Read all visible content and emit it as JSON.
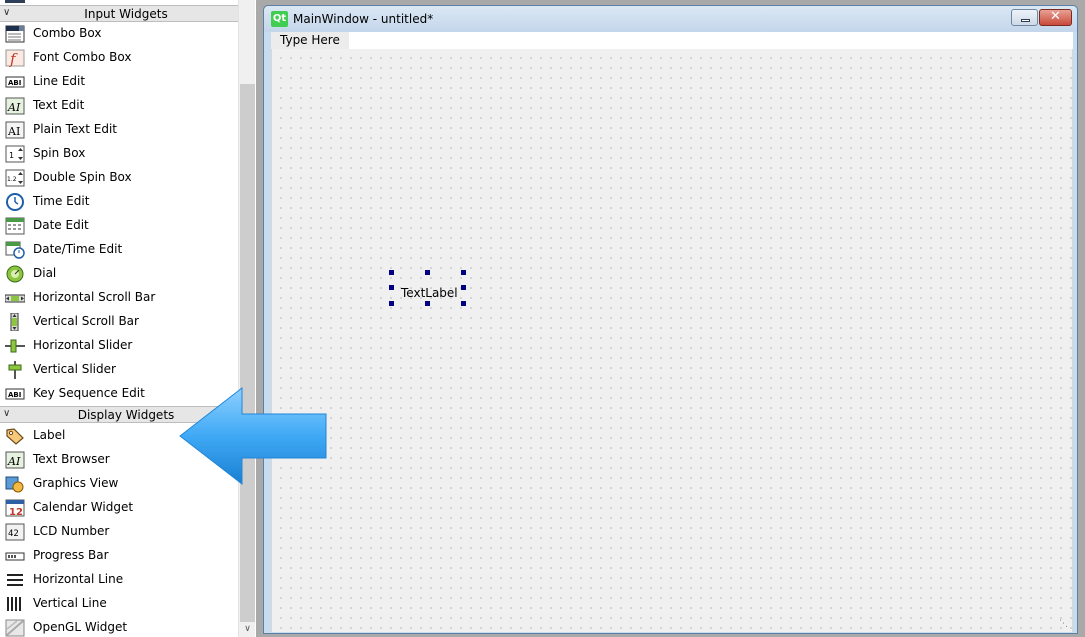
{
  "widget_box": {
    "categories": [
      {
        "title": "Input Widgets",
        "items": [
          {
            "label": "Combo Box",
            "icon": "combo-box-icon"
          },
          {
            "label": "Font Combo Box",
            "icon": "font-combo-box-icon"
          },
          {
            "label": "Line Edit",
            "icon": "line-edit-icon"
          },
          {
            "label": "Text Edit",
            "icon": "text-edit-icon"
          },
          {
            "label": "Plain Text Edit",
            "icon": "plain-text-edit-icon"
          },
          {
            "label": "Spin Box",
            "icon": "spin-box-icon"
          },
          {
            "label": "Double Spin Box",
            "icon": "double-spin-box-icon"
          },
          {
            "label": "Time Edit",
            "icon": "time-edit-icon"
          },
          {
            "label": "Date Edit",
            "icon": "date-edit-icon"
          },
          {
            "label": "Date/Time Edit",
            "icon": "date-time-edit-icon"
          },
          {
            "label": "Dial",
            "icon": "dial-icon"
          },
          {
            "label": "Horizontal Scroll Bar",
            "icon": "horizontal-scroll-bar-icon"
          },
          {
            "label": "Vertical Scroll Bar",
            "icon": "vertical-scroll-bar-icon"
          },
          {
            "label": "Horizontal Slider",
            "icon": "horizontal-slider-icon"
          },
          {
            "label": "Vertical Slider",
            "icon": "vertical-slider-icon"
          },
          {
            "label": "Key Sequence Edit",
            "icon": "key-sequence-edit-icon"
          }
        ]
      },
      {
        "title": "Display Widgets",
        "items": [
          {
            "label": "Label",
            "icon": "label-tag-icon"
          },
          {
            "label": "Text Browser",
            "icon": "text-browser-icon"
          },
          {
            "label": "Graphics View",
            "icon": "graphics-view-icon"
          },
          {
            "label": "Calendar Widget",
            "icon": "calendar-widget-icon"
          },
          {
            "label": "LCD Number",
            "icon": "lcd-number-icon"
          },
          {
            "label": "Progress Bar",
            "icon": "progress-bar-icon"
          },
          {
            "label": "Horizontal Line",
            "icon": "horizontal-line-icon"
          },
          {
            "label": "Vertical Line",
            "icon": "vertical-line-icon"
          },
          {
            "label": "OpenGL Widget",
            "icon": "opengl-widget-icon"
          }
        ]
      }
    ],
    "icon_text": {
      "line_edit": "ABI",
      "text_edit": "AI",
      "spin_box": "1",
      "double_spin_box": "1.2",
      "calendar": "12",
      "lcd": "42"
    }
  },
  "form": {
    "logo": "Qt",
    "title": "MainWindow - untitled*",
    "menu_placeholder": "Type Here",
    "text_label": "TextLabel",
    "close_glyph": "✕"
  },
  "colors": {
    "arrow": "#3fa9f5",
    "selection_handle": "#000080",
    "qt_green": "#41cd52"
  }
}
